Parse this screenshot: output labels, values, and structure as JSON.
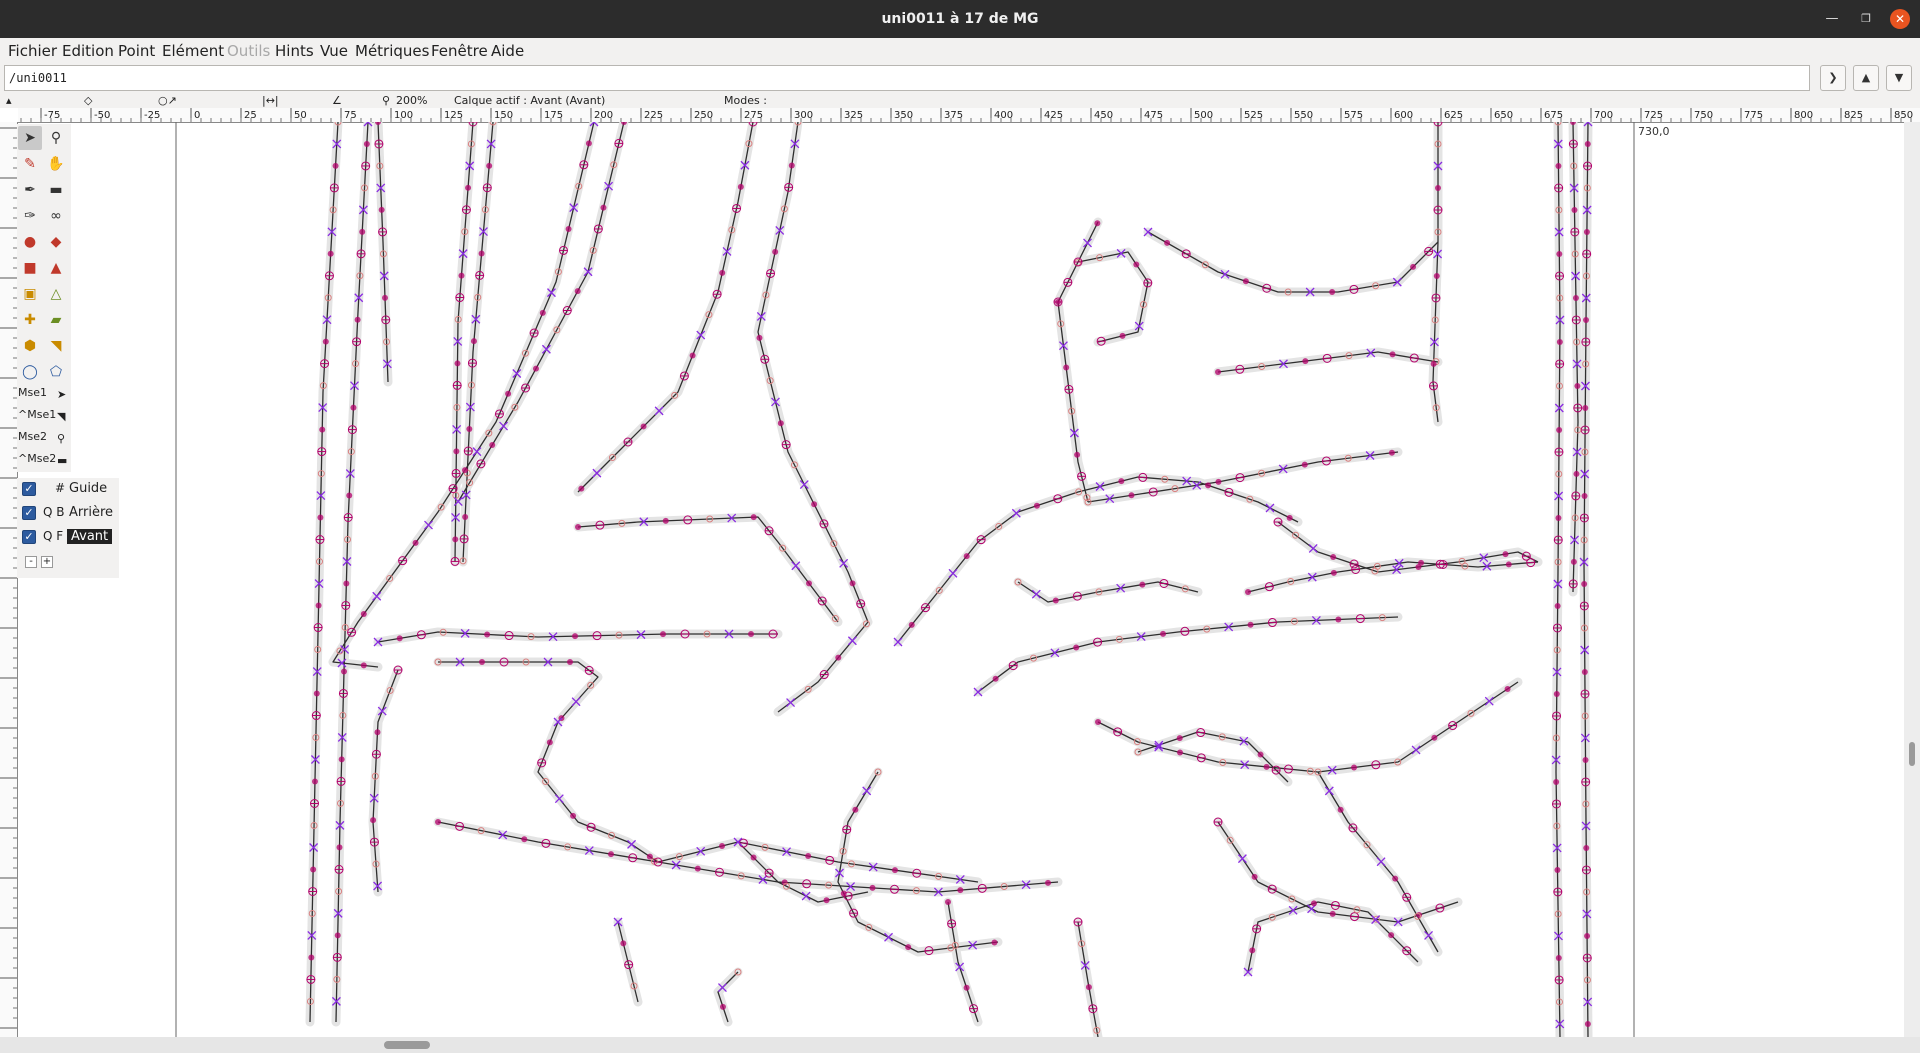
{
  "window": {
    "title": "uni0011 à 17 de MG",
    "minimize_icon": "—",
    "maximize_icon": "❐",
    "close_icon": "✕"
  },
  "menu": [
    "Fichier",
    "Edition",
    "Point",
    "Elément",
    "Outils",
    "Hints",
    "Vue",
    "Métriques",
    "Fenêtre",
    "Aide"
  ],
  "menu_disabled": [
    "Outils"
  ],
  "path": {
    "value": "/uni0011"
  },
  "info": {
    "zoom": "200%",
    "active_layer": "Calque actif : Avant (Avant)",
    "modes": "Modes :"
  },
  "ruler": {
    "h_labels": [
      "-75",
      "-50",
      "-25",
      "0",
      "25",
      "50",
      "75",
      "100",
      "125",
      "150",
      "175",
      "200",
      "225",
      "250",
      "275",
      "300",
      "325",
      "350",
      "375",
      "400",
      "425",
      "450",
      "475",
      "500",
      "525",
      "550",
      "575",
      "600",
      "625",
      "650",
      "675",
      "700",
      "725",
      "750",
      "775",
      "800",
      "825",
      "850"
    ]
  },
  "coord_readout": "730,0",
  "mouse_labels": [
    "Mse1",
    "^Mse1",
    "Mse2",
    "^Mse2"
  ],
  "layers": [
    {
      "code": "#",
      "name": "Guide",
      "checked": true
    },
    {
      "code": "Q B",
      "name": "Arrière",
      "checked": true
    },
    {
      "code": "Q F",
      "name": "Avant",
      "checked": true,
      "active": true
    }
  ],
  "layer_buttons": [
    "-",
    "+"
  ],
  "colors": {
    "outline": "#2e2e2e",
    "point_marker": "#b3006b",
    "control_marker": "#8a2be2",
    "hint_shadow": "#e4e4e4",
    "ruler_bg": "#fafafa",
    "titlebar": "#2c2c2c",
    "close_button": "#e95420",
    "layer_checkbox": "#2d5b9f"
  }
}
